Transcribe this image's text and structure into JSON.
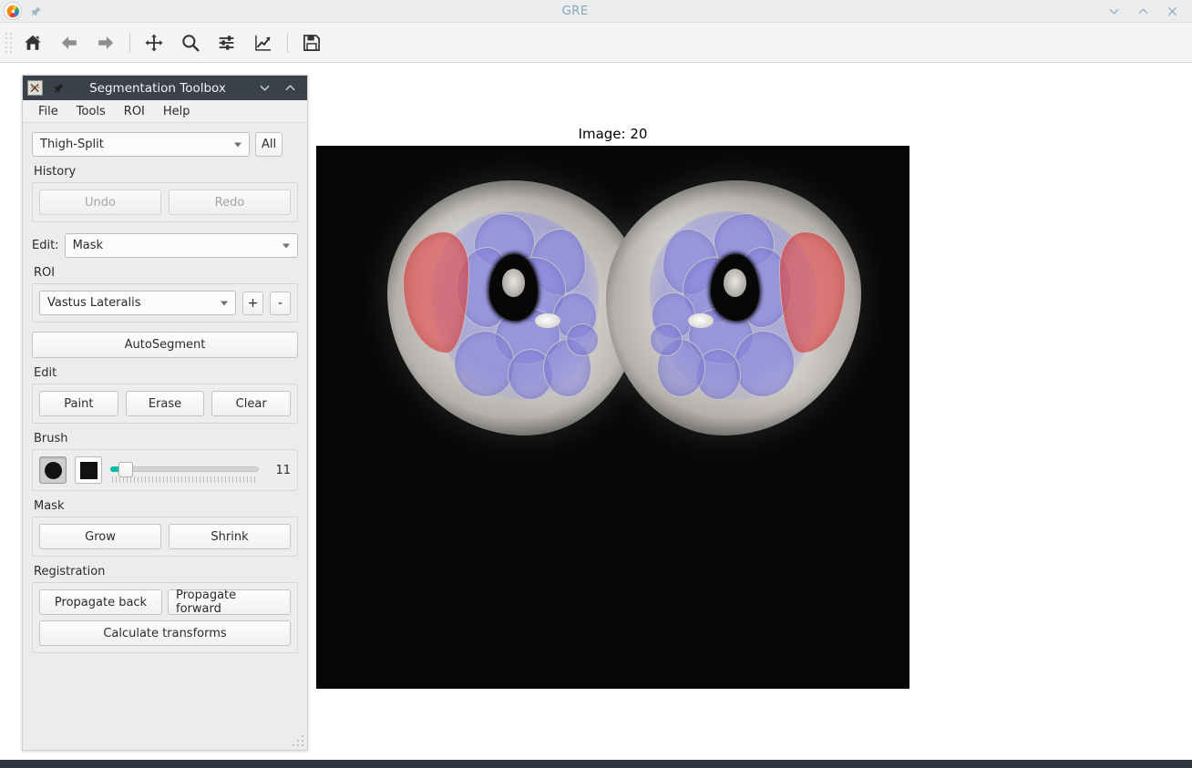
{
  "window": {
    "title": "GRE",
    "app_icon": "matplotlib-icon",
    "pin_icon": "pin-icon",
    "controls": [
      {
        "name": "minimize-button",
        "icon": "chevron-down-icon"
      },
      {
        "name": "maximize-button",
        "icon": "chevron-up-icon"
      },
      {
        "name": "close-button",
        "icon": "close-icon"
      }
    ]
  },
  "navbar": {
    "buttons": [
      {
        "name": "home-button",
        "icon": "home-icon",
        "title": "Home",
        "enabled": true
      },
      {
        "name": "back-button",
        "icon": "arrow-left-icon",
        "title": "Back",
        "enabled": false
      },
      {
        "name": "forward-button",
        "icon": "arrow-right-icon",
        "title": "Forward",
        "enabled": false
      },
      {
        "name": "pan-button",
        "icon": "move-arrows-icon",
        "title": "Pan",
        "enabled": true
      },
      {
        "name": "zoom-button",
        "icon": "magnifier-icon",
        "title": "Zoom",
        "enabled": true
      },
      {
        "name": "subplots-button",
        "icon": "sliders-icon",
        "title": "Configure subplots",
        "enabled": true
      },
      {
        "name": "customize-button",
        "icon": "line-chart-icon",
        "title": "Edit axis curves",
        "enabled": true
      },
      {
        "name": "save-button",
        "icon": "floppy-disk-icon",
        "title": "Save figure",
        "enabled": true
      }
    ]
  },
  "plot": {
    "title": "Image: 20",
    "background_color": "#080808",
    "overlay_colors": {
      "muscle_generic": "#8b89dd",
      "selected_roi": "#e25454"
    }
  },
  "toolbox": {
    "title": "Segmentation Toolbox",
    "icon": "matplotlib-icon",
    "pin_icon": "pin-icon",
    "controls": [
      {
        "name": "toolbox-minimize-button",
        "icon": "chevron-down-icon"
      },
      {
        "name": "toolbox-maximize-button",
        "icon": "chevron-up-icon"
      }
    ],
    "menu": [
      {
        "label": "File"
      },
      {
        "label": "Tools"
      },
      {
        "label": "ROI"
      },
      {
        "label": "Help"
      }
    ],
    "dataset": {
      "selected": "Thigh-Split",
      "options": [
        "Thigh-Split"
      ],
      "all_label": "All"
    },
    "history": {
      "label": "History",
      "undo_label": "Undo",
      "redo_label": "Redo",
      "undo_enabled": false,
      "redo_enabled": false
    },
    "edit_mode": {
      "label": "Edit:",
      "selected": "Mask",
      "options": [
        "Mask"
      ]
    },
    "roi": {
      "label": "ROI",
      "selected": "Vastus Lateralis",
      "options": [
        "Vastus Lateralis"
      ],
      "add_label": "+",
      "remove_label": "-"
    },
    "autosegment_label": "AutoSegment",
    "edit": {
      "label": "Edit",
      "paint_label": "Paint",
      "erase_label": "Erase",
      "clear_label": "Clear"
    },
    "brush": {
      "label": "Brush",
      "shape_round": "circle-brush-icon",
      "shape_square": "square-brush-icon",
      "selected_shape": "circle",
      "size": "11",
      "slider_min": "1",
      "slider_max": "100",
      "slider_color": "#00bfa5"
    },
    "mask": {
      "label": "Mask",
      "grow_label": "Grow",
      "shrink_label": "Shrink"
    },
    "registration": {
      "label": "Registration",
      "propagate_back_label": "Propagate back",
      "propagate_forward_label": "Propagate forward",
      "calculate_label": "Calculate transforms"
    },
    "resize_grip": "resize-grip-icon"
  }
}
